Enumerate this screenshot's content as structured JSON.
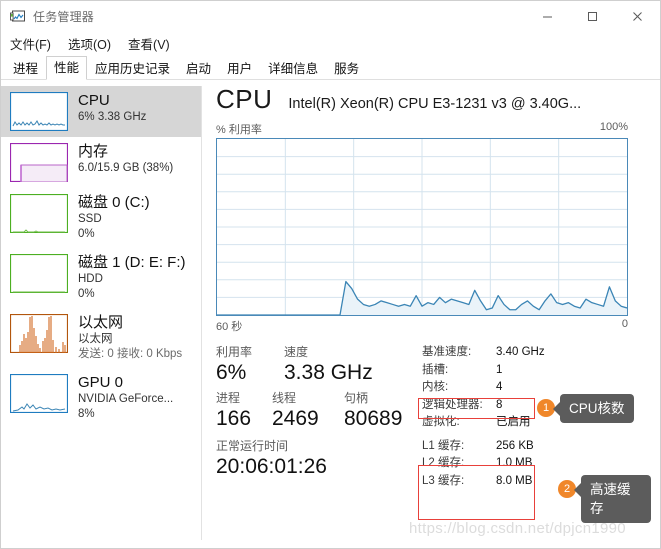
{
  "window": {
    "title": "任务管理器",
    "icon": "task-manager-icon",
    "minimize_label": "—",
    "maximize_label": "□",
    "close_label": "✕"
  },
  "menu": {
    "items": [
      {
        "label": "文件(F)"
      },
      {
        "label": "选项(O)"
      },
      {
        "label": "查看(V)"
      }
    ]
  },
  "tabs": [
    {
      "label": "进程",
      "active": false
    },
    {
      "label": "性能",
      "active": true
    },
    {
      "label": "应用历史记录",
      "active": false
    },
    {
      "label": "启动",
      "active": false
    },
    {
      "label": "用户",
      "active": false
    },
    {
      "label": "详细信息",
      "active": false
    },
    {
      "label": "服务",
      "active": false
    }
  ],
  "sidebar": {
    "items": [
      {
        "name": "cpu",
        "title": "CPU",
        "sub1": "6%  3.38 GHz",
        "sub2": "",
        "sub3": "",
        "selected": true,
        "color": "#1f7cc0"
      },
      {
        "name": "memory",
        "title": "内存",
        "sub1": "6.0/15.9 GB (38%)",
        "sub2": "",
        "sub3": "",
        "selected": false,
        "color": "#9b27b0"
      },
      {
        "name": "disk-0",
        "title": "磁盘 0 (C:)",
        "sub1": "SSD",
        "sub2": "0%",
        "sub3": "",
        "selected": false,
        "color": "#4caf22"
      },
      {
        "name": "disk-1",
        "title": "磁盘 1 (D: E: F:)",
        "sub1": "HDD",
        "sub2": "0%",
        "sub3": "",
        "selected": false,
        "color": "#4caf22"
      },
      {
        "name": "ethernet",
        "title": "以太网",
        "sub1": "以太网",
        "sub2": "发送: 0 接收: 0 Kbps",
        "sub3": "",
        "selected": false,
        "color": "#b2560d"
      },
      {
        "name": "gpu-0",
        "title": "GPU 0",
        "sub1": "NVIDIA GeForce...",
        "sub2": "8%",
        "sub3": "",
        "selected": false,
        "color": "#1f7cc0"
      }
    ]
  },
  "main": {
    "header_title": "CPU",
    "header_model": "Intel(R) Xeon(R) CPU E3-1231 v3 @ 3.40G...",
    "axis_left": "% 利用率",
    "axis_right": "100%",
    "time_left": "60 秒",
    "time_right": "0",
    "stats": {
      "utilization_label": "利用率",
      "utilization_value": "6%",
      "speed_label": "速度",
      "speed_value": "3.38 GHz",
      "processes_label": "进程",
      "processes_value": "166",
      "threads_label": "线程",
      "threads_value": "2469",
      "handles_label": "句柄",
      "handles_value": "80689",
      "uptime_label": "正常运行时间",
      "uptime_value": "20:06:01:26"
    },
    "details": [
      {
        "label": "基准速度:",
        "value": "3.40 GHz"
      },
      {
        "label": "插槽:",
        "value": "1"
      },
      {
        "label": "内核:",
        "value": "4"
      },
      {
        "label": "逻辑处理器:",
        "value": "8"
      },
      {
        "label": "虚拟化:",
        "value": "已启用"
      }
    ],
    "cache": [
      {
        "label": "L1 缓存:",
        "value": "256 KB"
      },
      {
        "label": "L2 缓存:",
        "value": "1.0 MB"
      },
      {
        "label": "L3 缓存:",
        "value": "8.0 MB"
      }
    ]
  },
  "annotations": [
    {
      "badge": "1",
      "text": "CPU核数"
    },
    {
      "badge": "2",
      "text": "高速缓存"
    }
  ],
  "watermark": "https://blog.csdn.net/dpjcn1990",
  "chart_data": {
    "type": "area",
    "title": "CPU 利用率",
    "xlabel": "",
    "ylabel": "% 利用率",
    "ylim": [
      0,
      100
    ],
    "xlim": [
      60,
      0
    ],
    "x_tick_labels": [
      "60 秒",
      "0"
    ],
    "y_tick_labels": [
      "100%"
    ],
    "grid": true,
    "grid_columns": 6,
    "grid_rows": 10,
    "line_color": "#3b85b5",
    "fill_color": "#eaf3f9",
    "series": [
      {
        "name": "CPU 利用率",
        "values": [
          0,
          0,
          0,
          0,
          0,
          0,
          0,
          0,
          0,
          0,
          0,
          0,
          0,
          0,
          0,
          0,
          0,
          0,
          0,
          0,
          0,
          0,
          19,
          15,
          9,
          6,
          5,
          6,
          8,
          7,
          6,
          5,
          6,
          5,
          11,
          5,
          7,
          6,
          10,
          7,
          9,
          8,
          7,
          6,
          14,
          8,
          3,
          4,
          11,
          6,
          3,
          3,
          6,
          8,
          5,
          3,
          8,
          12,
          7,
          6,
          7,
          5,
          4,
          9,
          7,
          6,
          5,
          16,
          8,
          5,
          4
        ]
      }
    ]
  }
}
